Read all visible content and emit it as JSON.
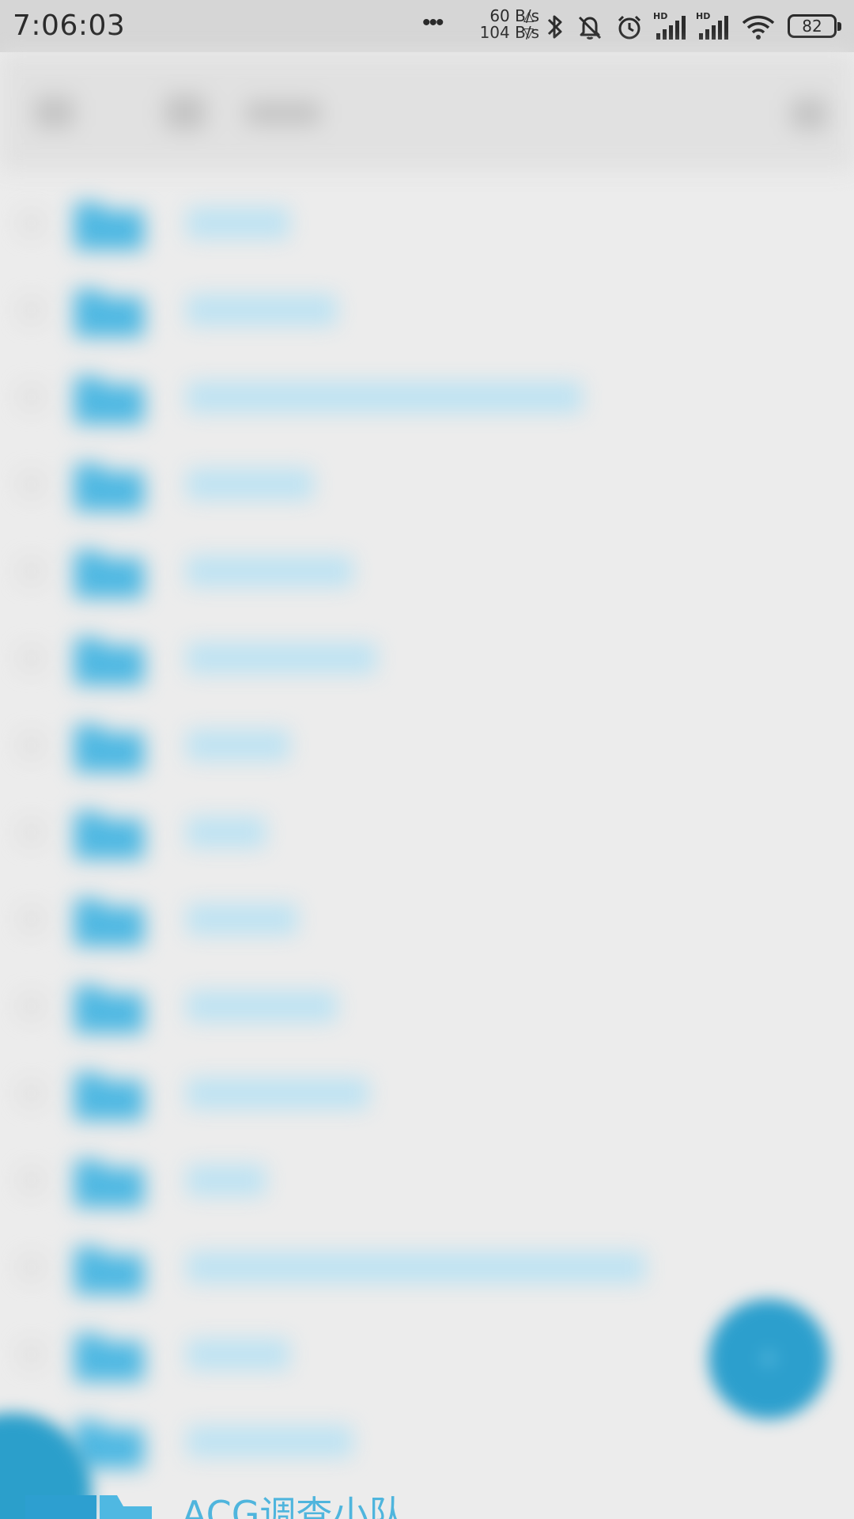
{
  "status_bar": {
    "time": "7:06:03",
    "more_dots": "•••",
    "net_up": "60 B/s",
    "net_down": "104 B/s",
    "up_arrow": "△",
    "down_arrow": "▽",
    "battery": "82",
    "icons": [
      "bluetooth-icon",
      "muted-bell-icon",
      "alarm-icon",
      "signal-hd-icon",
      "signal-hd-icon",
      "wifi-icon",
      "battery-icon"
    ]
  },
  "folder_list": {
    "rows": [
      {
        "name": ""
      },
      {
        "name": ""
      },
      {
        "name": ""
      },
      {
        "name": ""
      },
      {
        "name": ""
      },
      {
        "name": ""
      },
      {
        "name": ""
      },
      {
        "name": ""
      },
      {
        "name": ""
      },
      {
        "name": ""
      },
      {
        "name": ""
      },
      {
        "name": ""
      },
      {
        "name": ""
      },
      {
        "name": ""
      },
      {
        "name": ""
      }
    ],
    "peek_row_label": "ACG调查小队"
  },
  "colors": {
    "status_bar_bg": "#d6d6d6",
    "page_bg": "#ececec",
    "folder_blue": "#4fb8e2",
    "fab_blue": "#2c9fcd"
  }
}
